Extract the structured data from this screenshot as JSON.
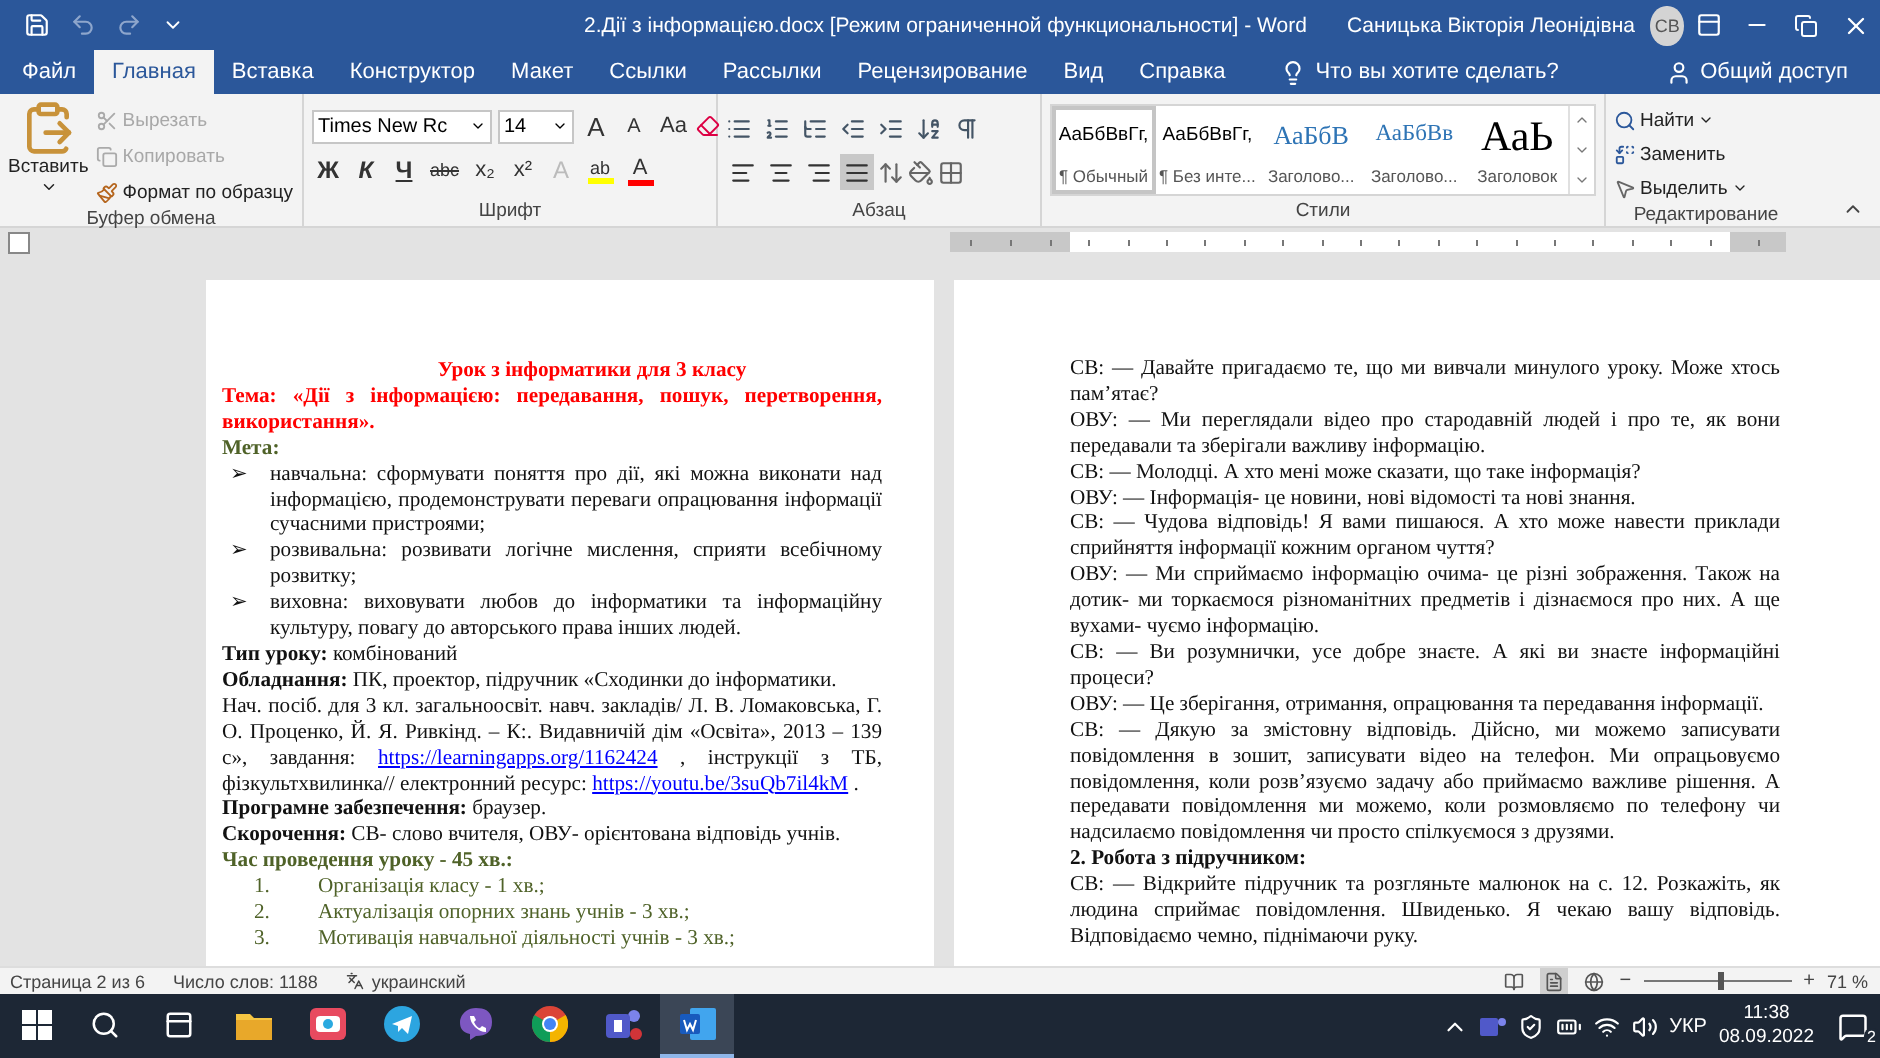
{
  "title_bar": {
    "title": "2.Дії з інформацією.docx [Режим ограниченной функциональности]  -  Word",
    "user": "Саницька Вікторія Леонідівна",
    "avatar": "СВ"
  },
  "tabs": [
    {
      "label": "Файл",
      "selected": false
    },
    {
      "label": "Главная",
      "selected": true
    },
    {
      "label": "Вставка",
      "selected": false
    },
    {
      "label": "Конструктор",
      "selected": false
    },
    {
      "label": "Макет",
      "selected": false
    },
    {
      "label": "Ссылки",
      "selected": false
    },
    {
      "label": "Рассылки",
      "selected": false
    },
    {
      "label": "Рецензирование",
      "selected": false
    },
    {
      "label": "Вид",
      "selected": false
    },
    {
      "label": "Справка",
      "selected": false
    }
  ],
  "tell_me": "Что вы хотите сделать?",
  "share": "Общий доступ",
  "clipboard": {
    "paste": "Вставить",
    "group": "Буфер обмена",
    "actions": [
      {
        "label": "Вырезать",
        "kind": "cut",
        "disabled": true
      },
      {
        "label": "Копировать",
        "kind": "copy",
        "disabled": true
      },
      {
        "label": "Формат по образцу",
        "kind": "painter",
        "disabled": false
      }
    ]
  },
  "font": {
    "name": "Times New Rc",
    "size": "14",
    "grow": "A",
    "shrink": "A",
    "case": "Aa",
    "bold": "Ж",
    "italic": "К",
    "underline": "Ч",
    "strike": "abc",
    "subscript": "x₂",
    "superscript": "x²",
    "effects": "A",
    "highlight": "ab",
    "font_color": "A",
    "group": "Шрифт"
  },
  "paragraph": {
    "group": "Абзац",
    "align": [
      {
        "kind": "left",
        "selected": false
      },
      {
        "kind": "center",
        "selected": false
      },
      {
        "kind": "right",
        "selected": false
      },
      {
        "kind": "justify",
        "selected": true
      }
    ]
  },
  "styles": {
    "group": "Стили",
    "items": [
      {
        "sample": "АаБбВвГг,",
        "name": "¶ Обычный",
        "kind": "normal",
        "selected": true
      },
      {
        "sample": "АаБбВвГг,",
        "name": "¶ Без инте...",
        "kind": "normal",
        "selected": false
      },
      {
        "sample": "АаБбВ",
        "name": "Заголово...",
        "kind": "heading1",
        "selected": false
      },
      {
        "sample": "АаБбВв",
        "name": "Заголово...",
        "kind": "heading2",
        "selected": false
      },
      {
        "sample": "АаЬ",
        "name": "Заголовок",
        "kind": "title",
        "selected": false
      }
    ]
  },
  "editing": {
    "group": "Редактирование",
    "find": "Найти",
    "replace": "Заменить",
    "select": "Выделить"
  },
  "left_page": [
    {
      "kind": "title",
      "text": "Урок з інформатики для 3 класу"
    },
    {
      "kind": "theme",
      "text": "Тема: «Дії з інформацією: передавання, пошук, перетворення, використання»."
    },
    {
      "kind": "heading",
      "text": "Мета:"
    },
    {
      "kind": "bullet",
      "marker": "➢",
      "text": "навчальна: сформувати поняття про дії, які можна виконати над інформацією, продемонструвати переваги опрацювання інформації сучасними пристроями;"
    },
    {
      "kind": "bullet",
      "marker": "➢",
      "text": "розвивальна: розвивати логічне мислення, сприяти всебічному розвитку;"
    },
    {
      "kind": "bullet",
      "marker": "➢",
      "text": "виховна: виховувати любов до інформатики та інформаційну культуру, повагу до авторського права інших людей."
    },
    {
      "kind": "label",
      "text": "**Тип уроку:** комбінований"
    },
    {
      "kind": "label",
      "text": "**Обладнання:** ПК, проектор, підручник «Сходинки до інформатики."
    },
    {
      "kind": "mixed",
      "parts": [
        {
          "kind": "text",
          "text": "Нач. посіб. для 3 кл. загальноосвіт. навч. закладів/  Л. В. Ломаковська, Г. О. Проценко, Й. Я. Ривкінд. – К:. Видавничій дім «Освіта», 2013 – 139 с», завдання: "
        },
        {
          "kind": "link",
          "text": "https://learningapps.org/1162424"
        },
        {
          "kind": "text",
          "text": " , інструкції з ТБ, фізкультхвилинка// електронний ресурс: "
        },
        {
          "kind": "link",
          "text": "https://youtu.be/3suQb7il4kM"
        },
        {
          "kind": "text",
          "text": " ."
        }
      ]
    },
    {
      "kind": "label",
      "text": "**Програмне забезпечення:** браузер."
    },
    {
      "kind": "label",
      "text": "**Скорочення:** СВ- слово вчителя, ОВУ- орієнтована відповідь учнів."
    },
    {
      "kind": "heading",
      "text": "Час проведення уроку - 45 хв.:"
    },
    {
      "kind": "numbered",
      "number": "1.",
      "text": "Організація класу -  1 хв.;"
    },
    {
      "kind": "numbered",
      "number": "2.",
      "text": "Актуалізація опорних знань учнів -  3 хв.;"
    },
    {
      "kind": "numbered",
      "number": "3.",
      "text": "Мотивація навчальної діяльності учнів -  3 хв.;"
    }
  ],
  "right_page": [
    {
      "kind": "plain",
      "text": "СВ: — Давайте пригадаємо те, що ми вивчали минулого уроку. Може хтось пам’ятає?"
    },
    {
      "kind": "plain",
      "text": "ОВУ: — Ми переглядали відео про стародавній людей і про те, як вони передавали та зберігали важливу інформацію."
    },
    {
      "kind": "plain",
      "text": "СВ: — Молодці. А хто мені може сказати, що таке інформація?"
    },
    {
      "kind": "plain",
      "text": "ОВУ: — Інформація- це новини, нові відомості та нові знання."
    },
    {
      "kind": "plain",
      "text": "СВ: — Чудова відповідь! Я вами пишаюся. А хто може навести приклади сприйняття інформації кожним органом чуття?"
    },
    {
      "kind": "plain",
      "text": "ОВУ: — Ми сприймаємо інформацію очима- це різні зображення. Також на дотик- ми торкаємося різноманітних предметів і дізнаємося про них. А ще вухами- чуємо інформацію."
    },
    {
      "kind": "plain",
      "text": "СВ: — Ви розумнички, усе добре знаєте. А які ви знаєте інформаційні процеси?"
    },
    {
      "kind": "plain",
      "text": "ОВУ: — Це зберігання, отримання, опрацювання та передавання інформації."
    },
    {
      "kind": "plain",
      "text": "СВ: — Дякую за змістовну відповідь. Дійсно, ми можемо записувати повідомлення в зошит, записувати відео на телефон. Ми опрацьовуємо повідомлення, коли розв’язуємо задачу або приймаємо важливе рішення. А передавати повідомлення ми можемо, коли розмовляємо по телефону чи надсилаємо повідомлення чи просто спілкуємося з друзями."
    },
    {
      "kind": "bold",
      "text": "2. Робота з підручником:"
    },
    {
      "kind": "plain",
      "text": "СВ: — Відкрийте підручник та розгляньте малюнок на с. 12. Розкажіть, як людина сприймає повідомлення. Швиденько. Я чекаю вашу відповідь. Відповідаємо чемно, піднімаючи руку."
    }
  ],
  "status_bar": {
    "page": "Страница 2 из 6",
    "words": "Число слов: 1188",
    "language": "украинский",
    "views": [
      {
        "kind": "read",
        "selected": false
      },
      {
        "kind": "print",
        "selected": true
      },
      {
        "kind": "web",
        "selected": false
      }
    ],
    "zoom": {
      "minus": "−",
      "plus": "+",
      "reading": "71 %",
      "level": 0.52
    }
  },
  "taskbar": {
    "apps": [
      {
        "kind": "explorer",
        "selected": false
      },
      {
        "kind": "media",
        "selected": false
      },
      {
        "kind": "telegram",
        "selected": false
      },
      {
        "kind": "viber",
        "selected": false
      },
      {
        "kind": "chrome",
        "selected": false
      },
      {
        "kind": "teams",
        "selected": false
      },
      {
        "kind": "word",
        "selected": true
      }
    ],
    "language": "УКР",
    "time": "11:38",
    "date": "08.09.2022",
    "notifications": "2"
  }
}
